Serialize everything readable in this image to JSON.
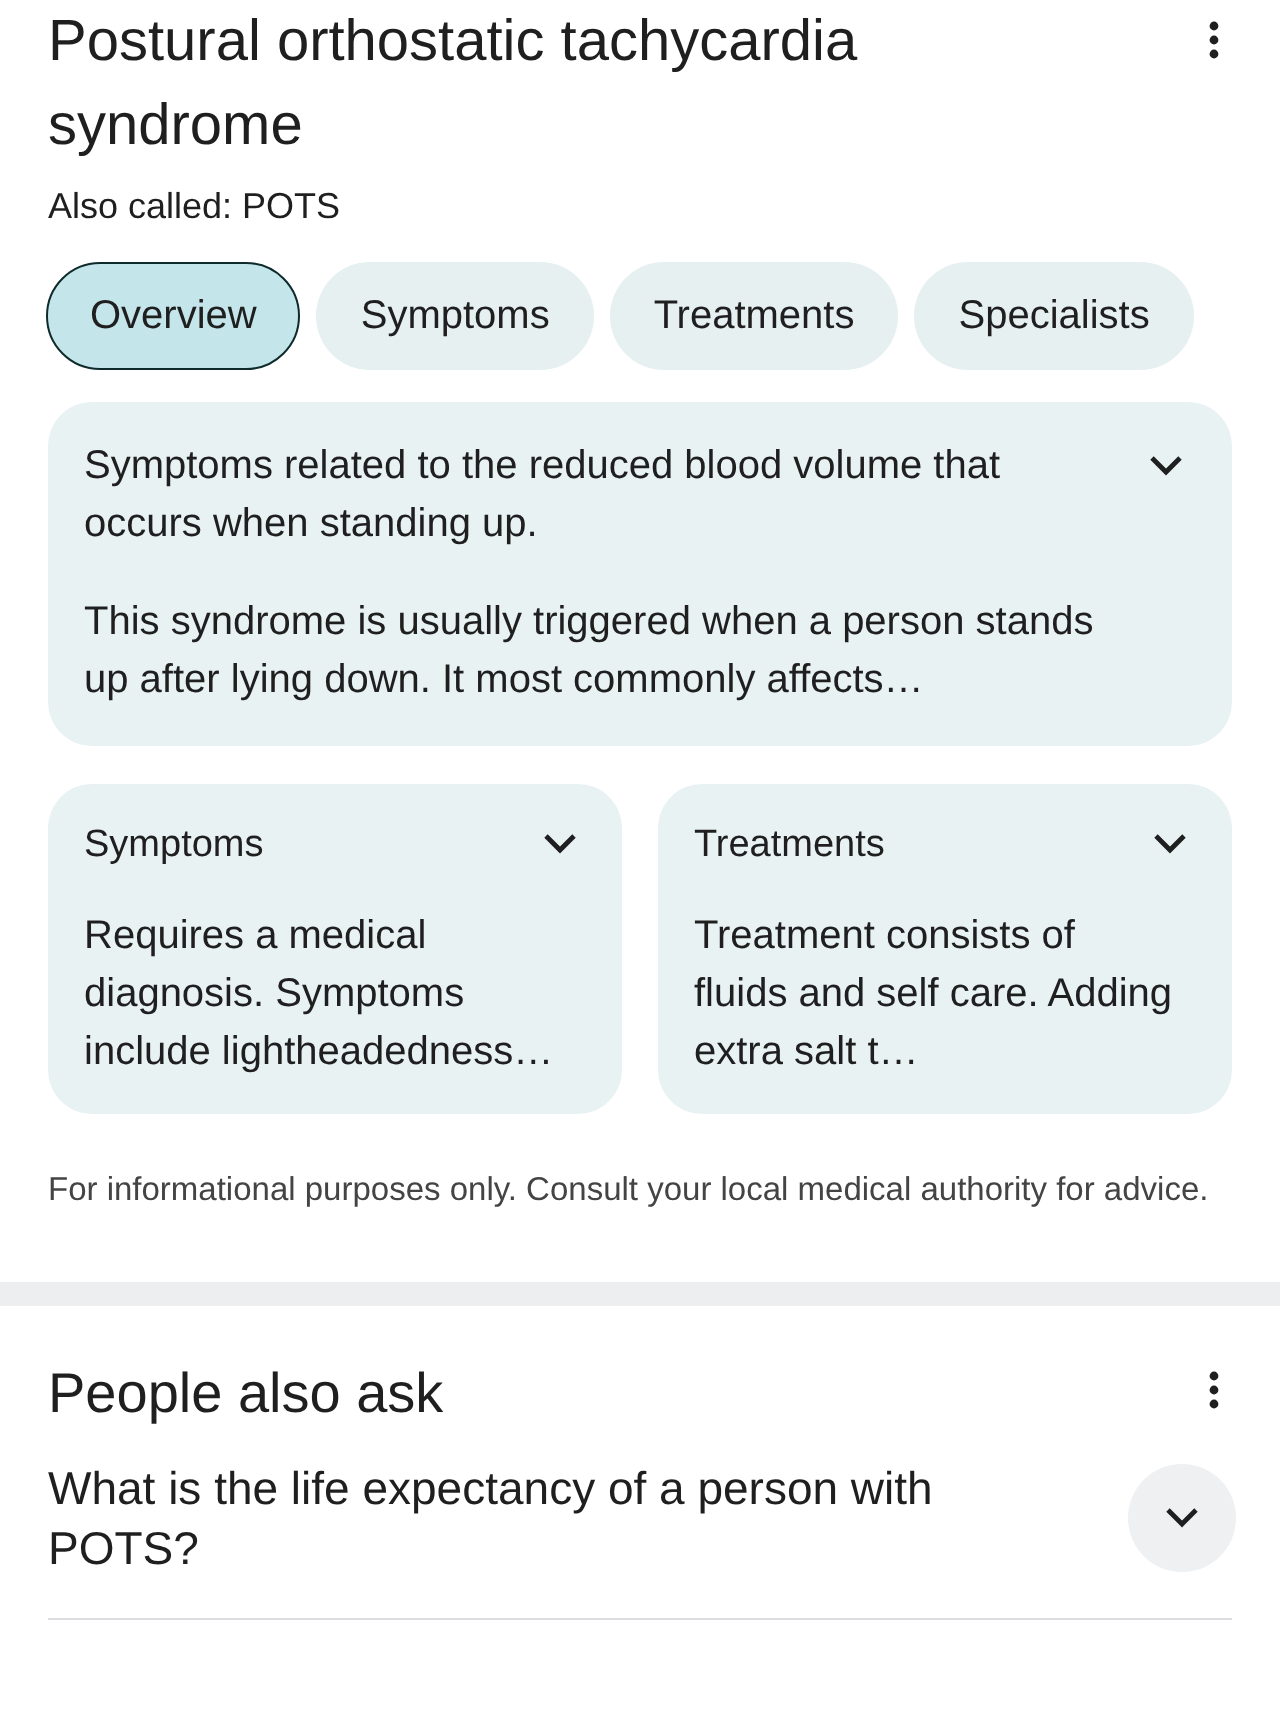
{
  "header": {
    "title": "Postural orthostatic tachycardia syndrome",
    "subtitle": "Also called: POTS"
  },
  "tabs": [
    {
      "label": "Overview",
      "selected": true
    },
    {
      "label": "Symptoms",
      "selected": false
    },
    {
      "label": "Treatments",
      "selected": false
    },
    {
      "label": "Specialists",
      "selected": false
    }
  ],
  "overview": {
    "summary": "Symptoms related to the reduced blood volume that occurs when standing up.",
    "detail": "This syndrome is usually triggered when a person stands up after lying down. It most commonly affects…"
  },
  "cards": [
    {
      "title": "Symptoms",
      "text": "Requires a medical diagnosis. Symptoms include lightheadedness…"
    },
    {
      "title": "Treatments",
      "text": "Treatment consists of fluids and self care. Adding extra salt t…"
    }
  ],
  "disclaimer": "For informational purposes only. Consult your local medical authority for advice.",
  "people_also_ask": {
    "title": "People also ask",
    "questions": [
      {
        "text": "What is the life expectancy of a person with POTS?"
      }
    ]
  }
}
